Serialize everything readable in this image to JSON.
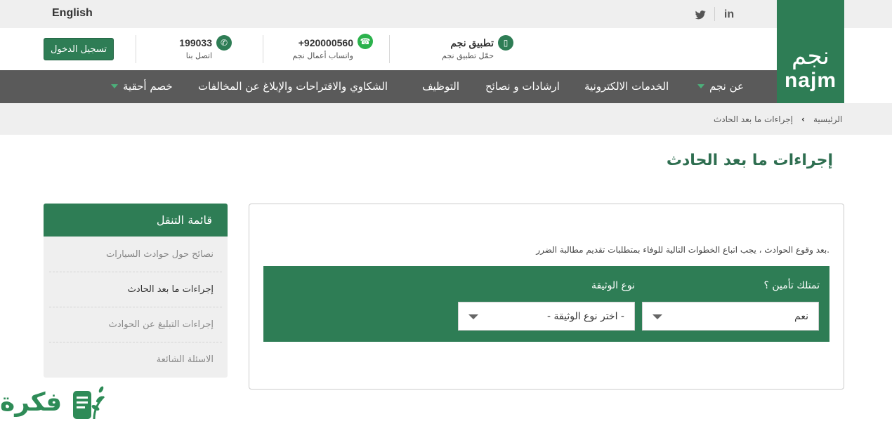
{
  "top": {
    "language_link": "English",
    "social": {
      "twitter": "twitter-icon",
      "linkedin": "linkedin-icon"
    }
  },
  "logo": {
    "ar": "نجم",
    "en": "najm"
  },
  "header": {
    "login_label": "تسجيل الدخول",
    "phone": {
      "number": "199033",
      "caption": "اتصل بنا"
    },
    "whatsapp": {
      "number": "+920000560",
      "caption": "واتساب أعمال نجم"
    },
    "app": {
      "title": "تطبيق نجم",
      "caption": "حمّل تطبيق نجم"
    }
  },
  "nav": {
    "items": [
      "عن نجم",
      "الخدمات الالكترونية",
      "ارشادات و نصائح",
      "التوظيف",
      "الشكاوي والاقتراحات والإبلاغ عن المخالفات",
      "خصم أحقية"
    ]
  },
  "breadcrumb": {
    "home": "الرئيسية",
    "current": "إجراءات ما بعد الحادث"
  },
  "page": {
    "title": "إجراءات ما بعد الحادث"
  },
  "content": {
    "intro": "بعد وقوع الحوادث ، يجب اتباع الخطوات التالية للوفاء بمتطلبات تقديم مطالبة الضرر.",
    "form": {
      "insurance_label": "تمتلك تأمين ؟",
      "insurance_value": "نعم",
      "doc_label": "نوع الوثيقة",
      "doc_value": "- اختر نوع الوثيقة -"
    }
  },
  "sidebar": {
    "title": "قائمة التنقل",
    "items": [
      "نصائح حول حوادث السيارات",
      "إجراءات ما بعد الحادث",
      "إجراءات التبليغ عن الحوادث",
      "الاسئلة الشائعة"
    ]
  },
  "watermark": {
    "text": "فكرة"
  },
  "colors": {
    "brand_green": "#2e7d55",
    "nav_gray": "#5a5a5a",
    "whatsapp": "#2bb24c"
  }
}
